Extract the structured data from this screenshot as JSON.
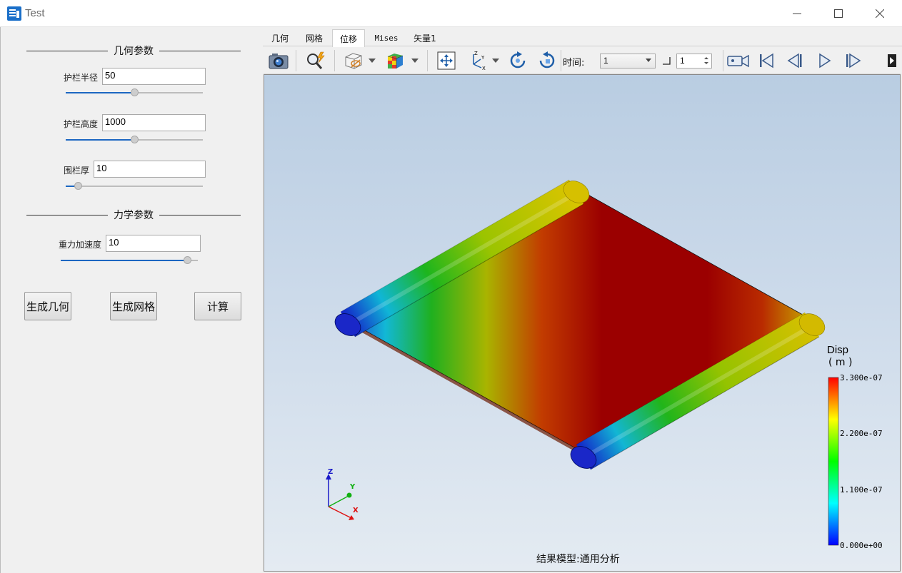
{
  "window": {
    "title": "Test",
    "controls": [
      "minimize",
      "maximize",
      "close"
    ]
  },
  "left_panel": {
    "geometry_section": {
      "title": "几何参数",
      "params": [
        {
          "label": "护栏半径",
          "value": "50",
          "slider_fraction": 0.5
        },
        {
          "label": "护栏高度",
          "value": "1000",
          "slider_fraction": 0.5
        },
        {
          "label": "围栏厚",
          "value": "10",
          "slider_fraction": 0.09
        }
      ]
    },
    "mechanics_section": {
      "title": "力学参数",
      "params": [
        {
          "label": "重力加速度",
          "value": "10",
          "slider_fraction": 0.92
        }
      ]
    },
    "buttons": [
      "生成几何",
      "生成网格",
      "计算"
    ]
  },
  "tabs": [
    "几何",
    "网格",
    "位移",
    "Mises",
    "矢量1"
  ],
  "active_tab": "位移",
  "toolbar": {
    "time_label": "时间:",
    "time_value": "1",
    "step_value": "1",
    "icons": [
      "camera-icon",
      "query-icon",
      "display-mode-icon",
      "color-map-icon",
      "fit-view-icon",
      "axis-icon",
      "rotate-cw-icon",
      "rotate-ccw-icon",
      "record-icon",
      "first-frame-icon",
      "prev-frame-icon",
      "play-icon",
      "next-frame-icon"
    ]
  },
  "viewport": {
    "legend": {
      "title": "Disp",
      "unit": "( m )",
      "ticks": [
        "3.300e-07",
        "2.200e-07",
        "1.100e-07",
        "0.000e+00"
      ],
      "max": 3.3e-07,
      "min": 0.0
    },
    "axes": {
      "z": "Z",
      "y": "Y",
      "x": "X"
    },
    "model_label": "结果模型:通用分析"
  }
}
